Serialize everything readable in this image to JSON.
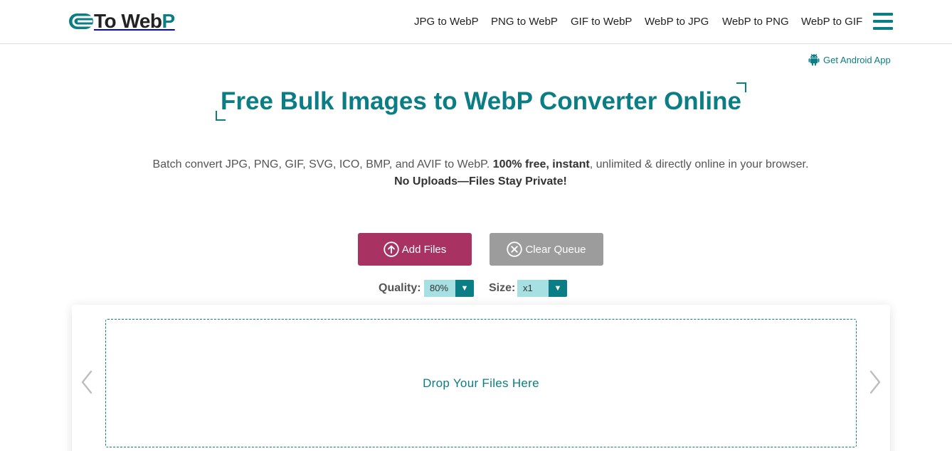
{
  "logo": {
    "text_main": "To Web",
    "text_accent": "P",
    "icon": "logo-mark-icon"
  },
  "nav": {
    "items": [
      {
        "label": "JPG to WebP"
      },
      {
        "label": "PNG to WebP"
      },
      {
        "label": "GIF to WebP"
      },
      {
        "label": "WebP to JPG"
      },
      {
        "label": "WebP to PNG"
      },
      {
        "label": "WebP to GIF"
      }
    ],
    "menu_icon": "hamburger-menu-icon"
  },
  "android": {
    "label": "Get Android App",
    "icon": "android-icon"
  },
  "hero": {
    "title": "Free Bulk Images to WebP Converter Online",
    "desc_part1": "Batch convert JPG, PNG, GIF, SVG, ICO, BMP, and AVIF to WebP. ",
    "desc_bold1": "100% free, instant",
    "desc_part2": ", unlimited & directly online in your browser.",
    "desc_bold2": "No Uploads—Files Stay Private!"
  },
  "actions": {
    "add_label": "Add Files",
    "add_icon": "upload-circle-icon",
    "clear_label": "Clear Queue",
    "clear_icon": "close-circle-icon"
  },
  "options": {
    "quality_label": "Quality:",
    "quality_value": "80%",
    "size_label": "Size:",
    "size_value": "x1",
    "arrow": "▼"
  },
  "dropzone": {
    "text": "Drop Your Files Here"
  },
  "colors": {
    "accent": "#0b7d84",
    "add_button": "#a83262",
    "clear_button": "#9c9c9c",
    "select_bg": "#a6e0e3"
  }
}
